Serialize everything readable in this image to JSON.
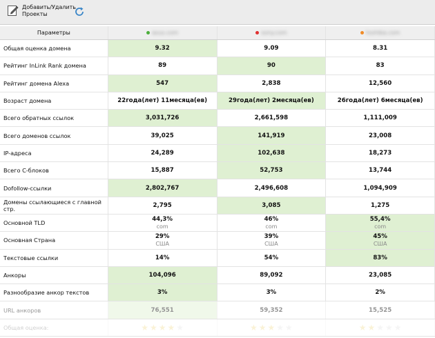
{
  "toolbar": {
    "add_remove_label": "Добавить/Удалить Проекты"
  },
  "header": {
    "param_label": "Параметры",
    "domains": [
      {
        "name": "asus.com",
        "dot_color": "#4cae3c"
      },
      {
        "name": "sony.com",
        "dot_color": "#e03131"
      },
      {
        "name": "toshiba.com",
        "dot_color": "#f08c28"
      }
    ]
  },
  "rows": [
    {
      "label": "Общая оценка домена",
      "values": [
        "9.32",
        "9.09",
        "8.31"
      ],
      "best": 0
    },
    {
      "label": "Рейтинг InLink Rank домена",
      "values": [
        "89",
        "90",
        "83"
      ],
      "best": 1
    },
    {
      "label": "Рейтинг домена Alexa",
      "values": [
        "547",
        "2,838",
        "12,560"
      ],
      "best": 0
    },
    {
      "label": "Возраст домена",
      "values": [
        "22года(лет) 11месяца(ев)",
        "29года(лет) 2месяца(ев)",
        "26года(лет) 6месяца(ев)"
      ],
      "best": 1
    },
    {
      "label": "Всего обратных ссылок",
      "values": [
        "3,031,726",
        "2,661,598",
        "1,111,009"
      ],
      "best": 0
    },
    {
      "label": "Всего доменов ссылок",
      "values": [
        "39,025",
        "141,919",
        "23,008"
      ],
      "best": 1
    },
    {
      "label": "IP-адреса",
      "values": [
        "24,289",
        "102,638",
        "18,273"
      ],
      "best": 1
    },
    {
      "label": "Всего C-блоков",
      "values": [
        "15,887",
        "52,753",
        "13,744"
      ],
      "best": 1
    },
    {
      "label": "Dofollow-ссылки",
      "values": [
        "2,802,767",
        "2,496,608",
        "1,094,909"
      ],
      "best": 0
    },
    {
      "label": "Домены ссылающиеся с главной стр.",
      "values": [
        "2,795",
        "3,085",
        "1,275"
      ],
      "best": 1
    },
    {
      "label": "Основной TLD",
      "values": [
        "44,3%",
        "46%",
        "55,4%"
      ],
      "subs": [
        "com",
        "com",
        "com"
      ],
      "best": 2
    },
    {
      "label": "Основная Страна",
      "values": [
        "29%",
        "39%",
        "45%"
      ],
      "subs": [
        "США",
        "США",
        "США"
      ],
      "best": 2
    },
    {
      "label": "Текстовые ссылки",
      "values": [
        "14%",
        "54%",
        "83%"
      ],
      "best": 2
    },
    {
      "label": "Анкоры",
      "values": [
        "104,096",
        "89,092",
        "23,085"
      ],
      "best": 0
    },
    {
      "label": "Разнообразие анкор текстов",
      "values": [
        "3%",
        "3%",
        "2%"
      ],
      "best": 0
    },
    {
      "label": "URL анкоров",
      "values": [
        "76,551",
        "59,352",
        "15,525"
      ],
      "best": 0,
      "fade": 1
    }
  ],
  "rating_row": {
    "label": "Общая оценка:",
    "stars": [
      4,
      3,
      2
    ],
    "max": 5
  },
  "colors": {
    "best_bg": "#dff0d2",
    "star_on": "#e8c23a",
    "star_off": "#cfcfcf"
  }
}
